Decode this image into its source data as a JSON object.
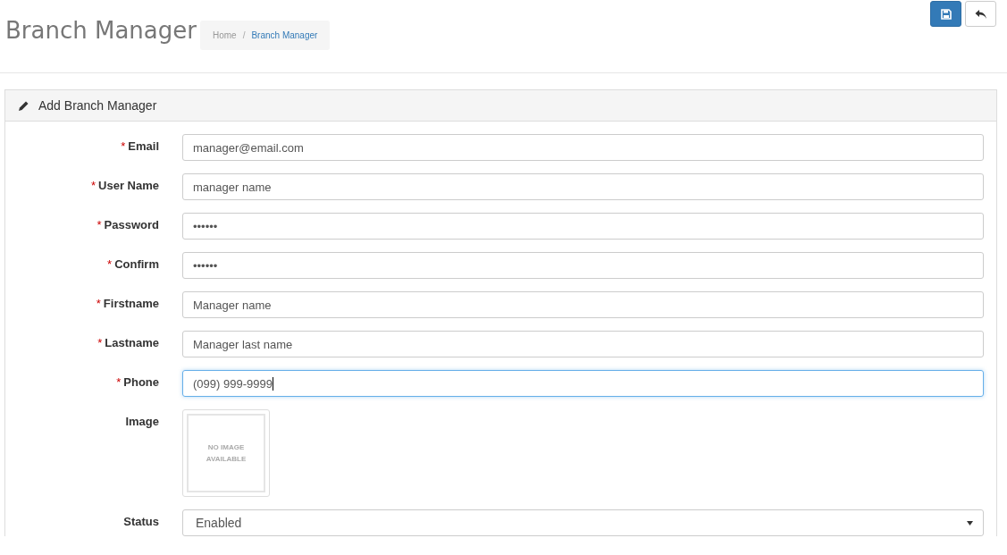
{
  "page_title": "Branch Manager",
  "breadcrumb_separator": "/",
  "breadcrumb": [
    {
      "label": "Home",
      "selected": false
    },
    {
      "label": "Branch Manager",
      "selected": true
    }
  ],
  "toolbar": [
    {
      "kind": "save"
    },
    {
      "kind": "back"
    }
  ],
  "panel": {
    "title": "Add Branch Manager",
    "fields": [
      {
        "kind": "text",
        "required_mark": "*",
        "label": "Email",
        "value": "manager@email.com",
        "focused": false
      },
      {
        "kind": "text",
        "required_mark": "*",
        "label": "User Name",
        "value": "manager name",
        "focused": false
      },
      {
        "kind": "text",
        "required_mark": "*",
        "label": "Password",
        "value": "••••••",
        "focused": false
      },
      {
        "kind": "text",
        "required_mark": "*",
        "label": "Confirm",
        "value": "••••••",
        "focused": false
      },
      {
        "kind": "text",
        "required_mark": "*",
        "label": "Firstname",
        "value": "Manager name",
        "focused": false
      },
      {
        "kind": "text",
        "required_mark": "*",
        "label": "Lastname",
        "value": "Manager last name",
        "focused": false
      },
      {
        "kind": "text",
        "required_mark": "*",
        "label": "Phone",
        "value": "(099) 999-9999",
        "focused": true
      },
      {
        "kind": "image",
        "label": "Image",
        "value": "NO IMAGE AVAILABLE"
      },
      {
        "kind": "select",
        "label": "Status",
        "value": "Enabled"
      }
    ]
  }
}
